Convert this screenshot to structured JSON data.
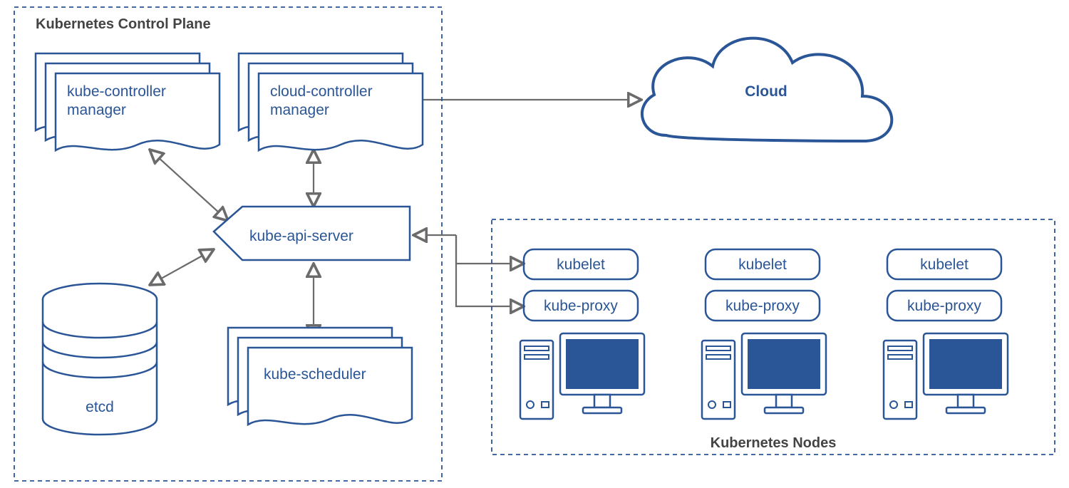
{
  "controlPlane": {
    "title": "Kubernetes Control Plane",
    "kubeControllerManager": "kube-controller\nmanager",
    "cloudControllerManager": "cloud-controller\nmanager",
    "kubeApiServer": "kube-api-server",
    "kubeScheduler": "kube-scheduler",
    "etcd": "etcd"
  },
  "nodesPanel": {
    "title": "Kubernetes Nodes",
    "nodes": [
      {
        "kubelet": "kubelet",
        "kubeProxy": "kube-proxy"
      },
      {
        "kubelet": "kubelet",
        "kubeProxy": "kube-proxy"
      },
      {
        "kubelet": "kubelet",
        "kubeProxy": "kube-proxy"
      }
    ]
  },
  "cloud": {
    "label": "Cloud"
  },
  "colors": {
    "accent": "#2a5596",
    "line": "#6b6b6b"
  }
}
